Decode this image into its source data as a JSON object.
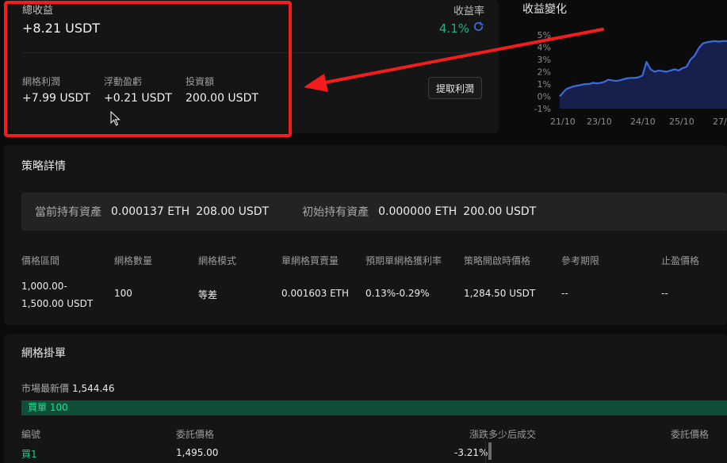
{
  "summary": {
    "total_label": "總收益",
    "total_value": "+8.21 USDT",
    "rate_label": "收益率",
    "rate_value": "4.1%",
    "grid_profit_label": "網格利潤",
    "grid_profit_value": "+7.99 USDT",
    "floating_label": "浮動盈虧",
    "floating_value": "+0.21 USDT",
    "investment_label": "投資額",
    "investment_value": "200.00 USDT",
    "withdraw_label": "提取利潤"
  },
  "chart": {
    "title": "收益變化"
  },
  "chart_data": {
    "type": "area",
    "title": "收益變化",
    "x_ticks": [
      "21/10",
      "23/10",
      "24/10",
      "25/10",
      "27/"
    ],
    "y_ticks": [
      "5%",
      "4%",
      "3%",
      "2%",
      "1%",
      "0%",
      "-1%"
    ],
    "ylim": [
      -1,
      5
    ],
    "x": [
      0,
      0.1,
      0.2,
      0.3,
      0.38,
      0.44,
      0.5,
      0.56,
      0.62,
      0.68,
      0.72,
      0.78,
      0.84,
      0.9,
      0.96,
      1.0,
      1.06,
      1.12,
      1.18,
      1.24,
      1.3,
      1.36,
      1.42,
      1.48,
      1.54,
      1.6,
      1.66,
      1.72,
      1.78,
      1.84,
      1.9,
      1.96,
      2.02,
      2.08,
      2.14,
      2.2,
      2.26,
      2.32,
      2.38,
      2.44,
      2.5,
      2.6
    ],
    "values": [
      0.0,
      0.6,
      0.8,
      0.9,
      1.0,
      1.0,
      1.1,
      1.05,
      1.1,
      1.2,
      1.35,
      1.3,
      1.25,
      1.3,
      1.4,
      1.45,
      1.5,
      1.5,
      1.55,
      1.7,
      2.8,
      2.2,
      2.0,
      2.1,
      2.05,
      2.0,
      2.1,
      2.2,
      2.1,
      2.3,
      2.4,
      3.0,
      3.3,
      3.9,
      4.3,
      4.4,
      4.45,
      4.5,
      4.45,
      4.5,
      4.5,
      4.5
    ],
    "grid": false,
    "line_color": "#3c6ae0",
    "fill_color": "#16204a"
  },
  "detail": {
    "title": "策略詳情",
    "current_label": "當前持有資產",
    "current_eth": "0.000137 ETH",
    "current_usdt": "208.00 USDT",
    "initial_label": "初始持有資產",
    "initial_eth": "0.000000 ETH",
    "initial_usdt": "200.00 USDT",
    "headers": [
      "價格區間",
      "網格數量",
      "網格模式",
      "單網格買賣量",
      "預期單網格獲利率",
      "策略開啟時價格",
      "參考期限",
      "止盈價格"
    ],
    "price_range_line1": "1,000.00-",
    "price_range_line2": "1,500.00 USDT",
    "values": [
      "100",
      "等差",
      "0.001603 ETH",
      "0.13%-0.29%",
      "1,284.50 USDT",
      "--",
      "--"
    ]
  },
  "orders": {
    "title": "網格掛單",
    "latest_label": "市場最新價",
    "latest_value": "1,544.46",
    "buy_bar_label": "買單 100",
    "headers": [
      "編號",
      "委託價格",
      "漲跌多少后成交",
      "委託價格"
    ],
    "row": [
      "買1",
      "1,495.00",
      "-3.21%"
    ]
  },
  "colors": {
    "accent_green": "#22b07d",
    "highlight_red": "#f31d1d",
    "chart_blue": "#3c6ae0"
  }
}
